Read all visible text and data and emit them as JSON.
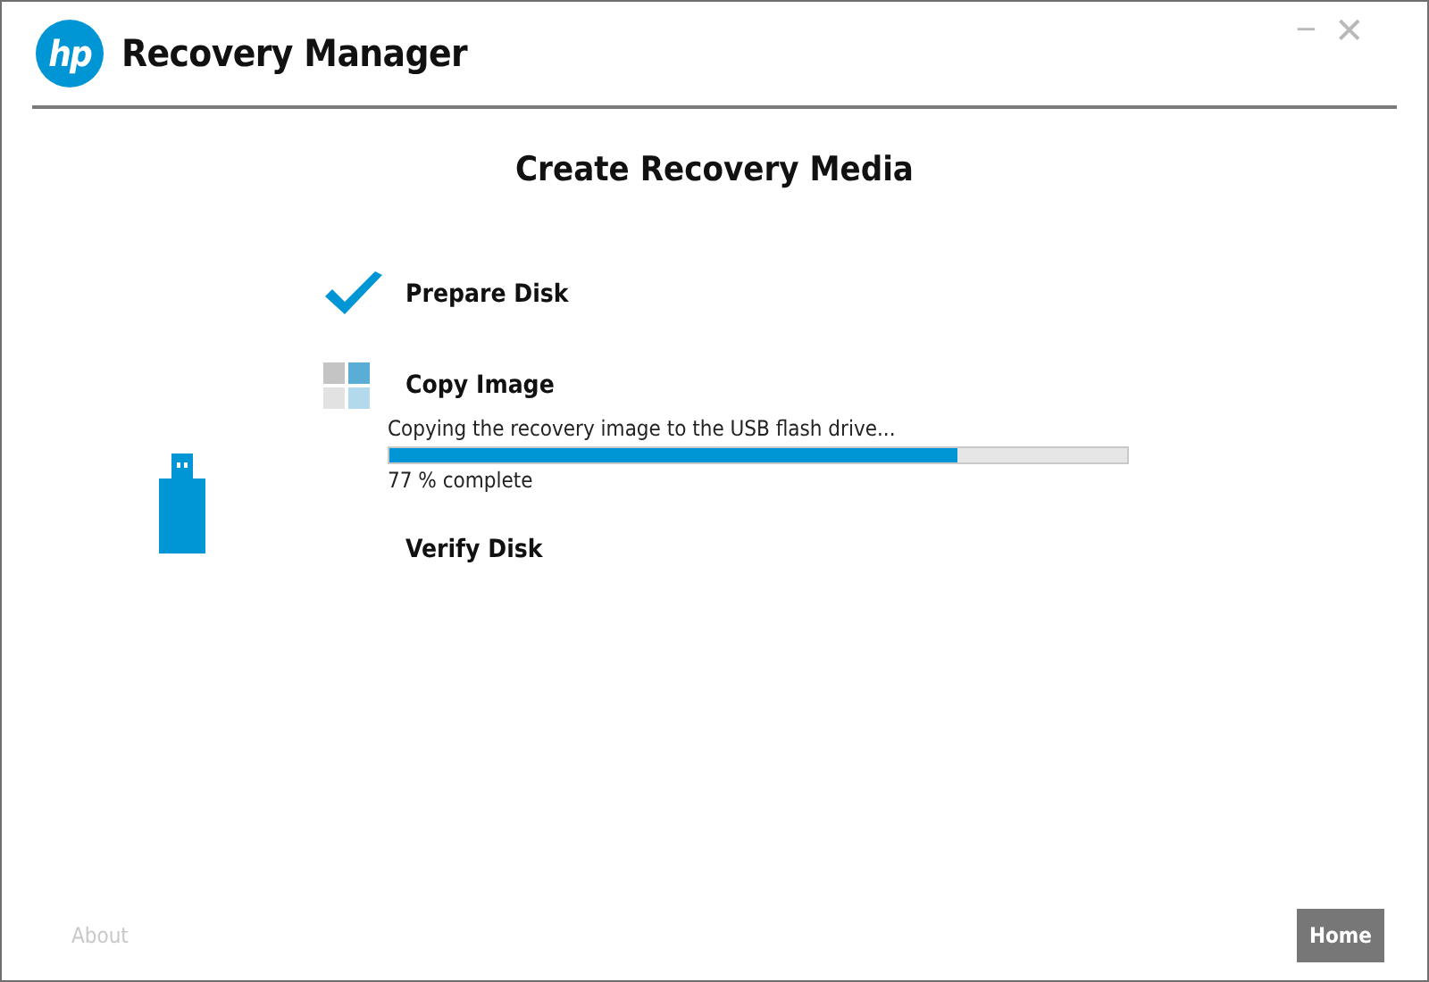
{
  "window": {
    "logo": "hp",
    "title": "Recovery Manager",
    "controls": [
      "−",
      "✕"
    ]
  },
  "heading": "Create Recovery Media",
  "steps": [
    {
      "label": "Prepare Disk",
      "kind": "done"
    },
    {
      "label": "Copy Image",
      "kind": "active",
      "detail": "Copying the recovery image to the USB flash drive...",
      "level": 0.77,
      "reading": "77 % complete"
    },
    {
      "label": "Verify Disk",
      "kind": "pending"
    }
  ],
  "footer": {
    "about": "About",
    "home": "Home"
  }
}
